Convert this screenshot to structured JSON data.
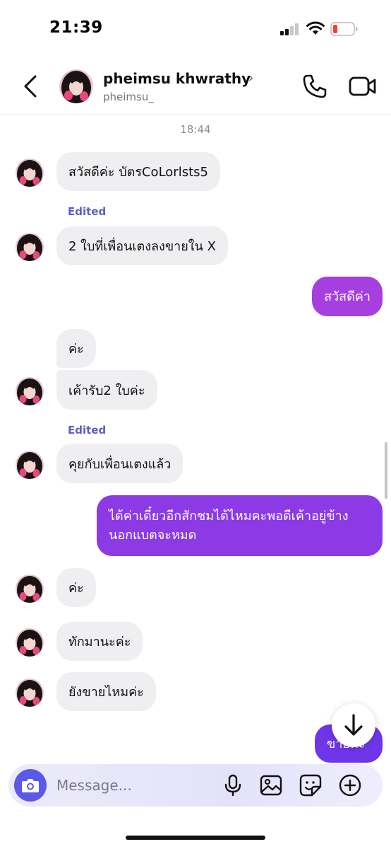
{
  "status_bar": {
    "time": "21:39"
  },
  "header": {
    "name": "pheimsu khwrathy",
    "chevron": "›",
    "handle": "pheimsu_"
  },
  "chat": {
    "timestamp": "18:44",
    "edited_label": "Edited",
    "messages": [
      {
        "from": "them",
        "text": "สวัสดีค่ะ  บัตรCoLorlsts5"
      },
      {
        "from": "them",
        "text": "2 ใบที่เพื่อนเตงลงขายใน X",
        "edited": true
      },
      {
        "from": "me",
        "text": "สวัสดีค่า"
      },
      {
        "from": "them",
        "text": "ค่ะ"
      },
      {
        "from": "them",
        "text": "เค้ารับ2 ใบค่ะ"
      },
      {
        "from": "them",
        "text": "คุยกับเพื่อนเตงแล้ว",
        "edited": true
      },
      {
        "from": "me",
        "text": "ได้ค่าเดี๋ยวอีกสักชมได้ไหมคะพอดีเค้าอยู่ข้างนอกแบตจะหมด"
      },
      {
        "from": "them",
        "text": "ค่ะ"
      },
      {
        "from": "them",
        "text": "ทักมานะค่ะ"
      },
      {
        "from": "them",
        "text": "ยังขายไหมค่ะ"
      },
      {
        "from": "me",
        "text": "ขายค่ะ"
      }
    ]
  },
  "composer": {
    "placeholder": "Message..."
  },
  "icons": {
    "back": "chevron-left-icon",
    "call": "phone-icon",
    "video": "video-camera-icon",
    "scroll": "arrow-down-icon",
    "camera": "camera-icon",
    "mic": "microphone-icon",
    "gallery": "image-icon",
    "sticker": "sticker-icon",
    "add": "plus-circle-icon"
  },
  "colors": {
    "outgoing_light": "#a63fe0",
    "outgoing_dark": "#6a35ea",
    "incoming": "#efeff2",
    "edited": "#5b5fc7",
    "camera_button": "#5a59e8"
  }
}
